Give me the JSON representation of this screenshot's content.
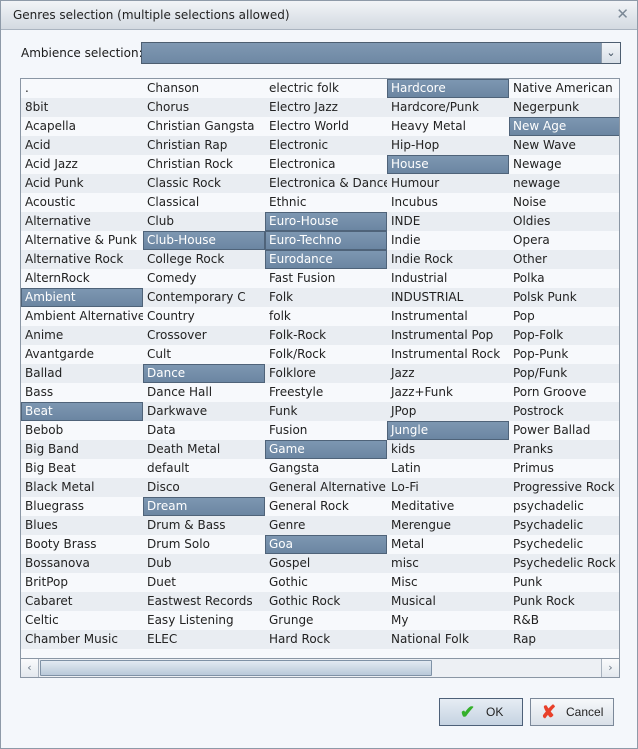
{
  "window": {
    "title": "Genres selection (multiple selections allowed)",
    "close_icon": "close-icon"
  },
  "ambience": {
    "label": "Ambience selection:",
    "value": ""
  },
  "colors": {
    "selected_bg": "#7490ac",
    "row_alt": "#e9edf2",
    "row_bg": "#f7f9fc",
    "ok_check": "#35b02b",
    "cancel_x": "#e8402a"
  },
  "genres": {
    "columns": [
      [
        ".",
        "8bit",
        "Acapella",
        "Acid",
        "Acid Jazz",
        "Acid Punk",
        "Acoustic",
        "Alternative",
        "Alternative & Punk",
        "Alternative Rock",
        "AlternRock",
        "Ambient",
        "Ambient Alternative",
        "Anime",
        "Avantgarde",
        "Ballad",
        "Bass",
        "Beat",
        "Bebob",
        "Big Band",
        "Big Beat",
        "Black Metal",
        "Bluegrass",
        "Blues",
        "Booty Brass",
        "Bossanova",
        "BritPop",
        "Cabaret",
        "Celtic",
        "Chamber Music"
      ],
      [
        "Chanson",
        "Chorus",
        "Christian Gangsta",
        "Christian Rap",
        "Christian Rock",
        "Classic Rock",
        "Classical",
        "Club",
        "Club-House",
        "College Rock",
        "Comedy",
        "Contemporary C",
        "Country",
        "Crossover",
        "Cult",
        "Dance",
        "Dance Hall",
        "Darkwave",
        "Data",
        "Death Metal",
        "default",
        "Disco",
        "Dream",
        "Drum & Bass",
        "Drum Solo",
        "Dub",
        "Duet",
        "Eastwest Records",
        "Easy Listening",
        "ELEC"
      ],
      [
        "electric folk",
        "Electro Jazz",
        "Electro World",
        "Electronic",
        "Electronica",
        "Electronica & Dance",
        "Ethnic",
        "Euro-House",
        "Euro-Techno",
        "Eurodance",
        "Fast Fusion",
        "Folk",
        "folk",
        "Folk-Rock",
        "Folk/Rock",
        "Folklore",
        "Freestyle",
        "Funk",
        "Fusion",
        "Game",
        "Gangsta",
        "General Alternative",
        "General Rock",
        "Genre",
        "Goa",
        "Gospel",
        "Gothic",
        "Gothic Rock",
        "Grunge",
        "Hard Rock"
      ],
      [
        "Hardcore",
        "Hardcore/Punk",
        "Heavy Metal",
        "Hip-Hop",
        "House",
        "Humour",
        "Incubus",
        "INDE",
        "Indie",
        "Indie Rock",
        "Industrial",
        "INDUSTRIAL",
        "Instrumental",
        "Instrumental Pop",
        "Instrumental Rock",
        "Jazz",
        "Jazz+Funk",
        "JPop",
        "Jungle",
        "kids",
        "Latin",
        "Lo-Fi",
        "Meditative",
        "Merengue",
        "Metal",
        "misc",
        "Misc",
        "Musical",
        "My",
        "National Folk"
      ],
      [
        "Native American",
        "Negerpunk",
        "New Age",
        "New Wave",
        "Newage",
        "newage",
        "Noise",
        "Oldies",
        "Opera",
        "Other",
        "Polka",
        "Polsk Punk",
        "Pop",
        "Pop-Folk",
        "Pop-Punk",
        "Pop/Funk",
        "Porn Groove",
        "Postrock",
        "Power Ballad",
        "Pranks",
        "Primus",
        "Progressive Rock",
        "psychadelic",
        "Psychadelic",
        "Psychedelic",
        "Psychedelic Rock",
        "Punk",
        "Punk Rock",
        "R&B",
        "Rap"
      ]
    ],
    "selected": [
      "Ambient",
      "Beat",
      "Club-House",
      "Dance",
      "Dream",
      "Euro-House",
      "Euro-Techno",
      "Eurodance",
      "Game",
      "Goa",
      "Hardcore",
      "House",
      "Jungle",
      "New Age"
    ]
  },
  "scrollbar": {
    "left_icon": "chevron-left-icon",
    "right_icon": "chevron-right-icon",
    "position_fraction": 0.0,
    "visible_fraction": 0.68
  },
  "buttons": {
    "ok_label": "OK",
    "cancel_label": "Cancel"
  }
}
